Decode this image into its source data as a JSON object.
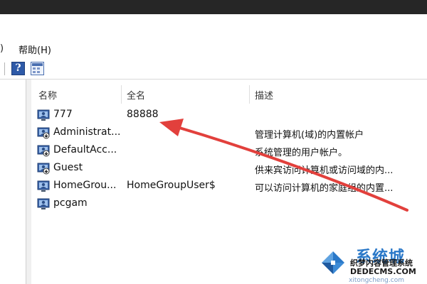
{
  "menu": {
    "fragment": ")",
    "help_label": "帮助(H)"
  },
  "toolbar": {
    "help_glyph": "?"
  },
  "columns": {
    "name": "名称",
    "fullname": "全名",
    "description": "描述"
  },
  "users": [
    {
      "name": "777",
      "fullname": "88888",
      "description": ""
    },
    {
      "name": "Administrat...",
      "fullname": "",
      "description": "管理计算机(域)的内置帐户"
    },
    {
      "name": "DefaultAcc...",
      "fullname": "",
      "description": "系统管理的用户帐户。"
    },
    {
      "name": "Guest",
      "fullname": "",
      "description": "供来宾访问计算机或访问域的内..."
    },
    {
      "name": "HomeGrou...",
      "fullname": "HomeGroupUser$",
      "description": "可以访问计算机的家庭组的内置..."
    },
    {
      "name": "pcgam",
      "fullname": "",
      "description": ""
    }
  ],
  "icons": {
    "user": "user-account-icon",
    "disabled_user": "disabled-user-account-icon",
    "help": "help-icon",
    "view": "show-hide-pane-icon"
  },
  "colors": {
    "annotation_arrow": "#e2403c",
    "watermark_brand": "#2a78c8"
  },
  "watermark": {
    "brand": "系统城",
    "sub": "织梦内容管理系统",
    "domain": "DEDECMS.COM",
    "url": "xitongcheng.com"
  }
}
